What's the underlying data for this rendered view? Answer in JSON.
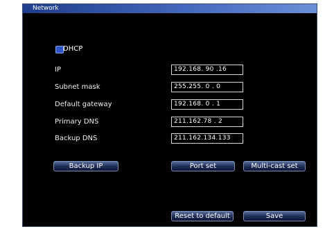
{
  "window": {
    "title": "Network"
  },
  "dhcp": {
    "label": "DHCP",
    "checked": true
  },
  "fields": [
    {
      "label": "IP",
      "value": "192.168. 90 .16"
    },
    {
      "label": "Subnet mask",
      "value": "255.255. 0 . 0"
    },
    {
      "label": "Default gateway",
      "value": "192.168. 0 . 1"
    },
    {
      "label": "Primary DNS",
      "value": "211.162.78 . 2"
    },
    {
      "label": "Backup DNS",
      "value": "211.162.134.133"
    }
  ],
  "buttons": {
    "backup_ip": "Backup IP",
    "port_set": "Port set",
    "multicast_set": "Multi-cast set",
    "reset_default": "Reset to default",
    "save": "Save"
  }
}
